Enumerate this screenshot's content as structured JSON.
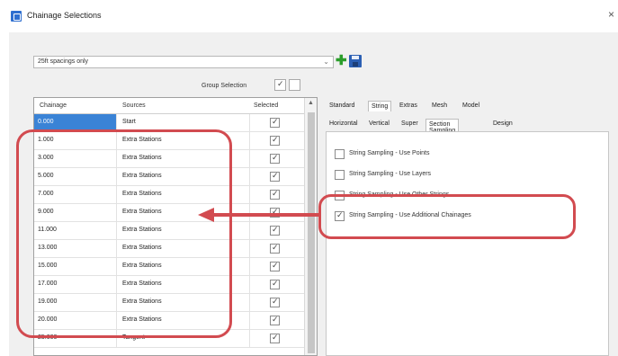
{
  "window": {
    "title": "Chainage Selections",
    "close_label": "×"
  },
  "filter": {
    "selected": "25ft spacings only"
  },
  "group_selection": {
    "label": "Group Selection"
  },
  "table": {
    "headers": {
      "chainage": "Chainage",
      "sources": "Sources",
      "selected": "Selected"
    },
    "rows": [
      {
        "chainage": "0.000",
        "source": "Start"
      },
      {
        "chainage": "1.000",
        "source": "Extra Stations"
      },
      {
        "chainage": "3.000",
        "source": "Extra Stations"
      },
      {
        "chainage": "5.000",
        "source": "Extra Stations"
      },
      {
        "chainage": "7.000",
        "source": "Extra Stations"
      },
      {
        "chainage": "9.000",
        "source": "Extra Stations"
      },
      {
        "chainage": "11.000",
        "source": "Extra Stations"
      },
      {
        "chainage": "13.000",
        "source": "Extra Stations"
      },
      {
        "chainage": "15.000",
        "source": "Extra Stations"
      },
      {
        "chainage": "17.000",
        "source": "Extra Stations"
      },
      {
        "chainage": "19.000",
        "source": "Extra Stations"
      },
      {
        "chainage": "20.000",
        "source": "Extra Stations"
      },
      {
        "chainage": "25.000",
        "source": "Tangent"
      }
    ]
  },
  "tabs_primary": [
    "Standard",
    "String",
    "Extras",
    "Mesh",
    "Model"
  ],
  "tabs_secondary": [
    "Horizontal",
    "Vertical",
    "Super",
    "Section Sampling",
    "Design"
  ],
  "options": [
    {
      "label": "String Sampling - Use Points",
      "checked": false
    },
    {
      "label": "String Sampling - Use Layers",
      "checked": false
    },
    {
      "label": "String Sampling - Use Other Strings",
      "checked": false
    },
    {
      "label": "String Sampling - Use Additional Chainages",
      "checked": true
    }
  ],
  "icons": {
    "app": "app-icon",
    "add": "add-icon",
    "save": "save-icon",
    "dropdown": "chevron-down-icon",
    "scroll_up": "scroll-up-icon",
    "arrow": "arrow-left-icon"
  },
  "colors": {
    "accent": "#3a83d6",
    "callout": "#d24b50",
    "add": "#2a9d2a",
    "save": "#2b5fb3"
  }
}
